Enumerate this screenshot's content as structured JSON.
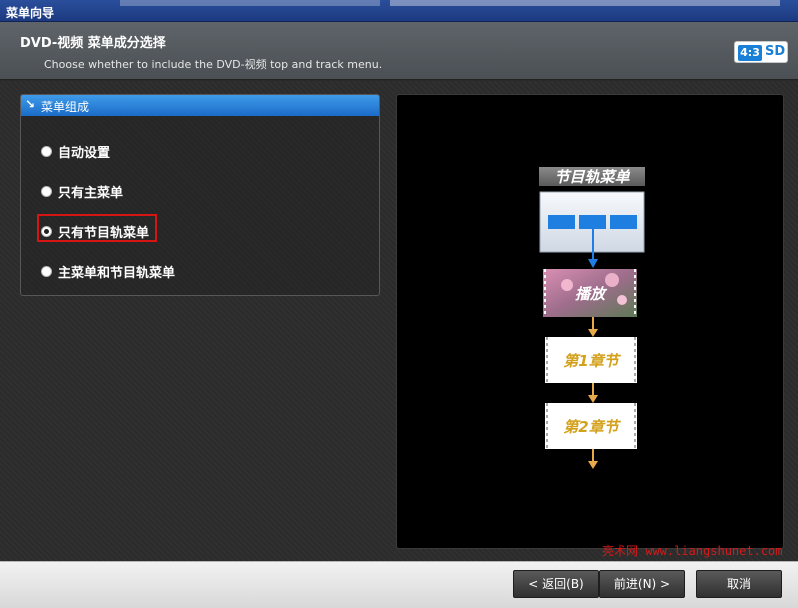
{
  "window": {
    "title": "菜单向导"
  },
  "header": {
    "title": "DVD-视频 菜单成分选择",
    "subtitle": "Choose whether to include the DVD-视频 top and track menu.",
    "badge": {
      "ratio": "4:3",
      "definition": "SD"
    }
  },
  "group": {
    "title": "菜单组成",
    "options": [
      {
        "label": "自动设置",
        "checked": false
      },
      {
        "label": "只有主菜单",
        "checked": false
      },
      {
        "label": "只有节目轨菜单",
        "checked": true
      },
      {
        "label": "主菜单和节目轨菜单",
        "checked": false
      }
    ]
  },
  "preview": {
    "menu_title": "节目轨菜单",
    "play_label": "播放",
    "chapters": [
      "第1章节",
      "第2章节"
    ]
  },
  "watermark": "亮术网 www.liangshunet.com",
  "footer": {
    "back_label": "< 返回(B)",
    "next_label": "前进(N) >",
    "cancel_label": "取消"
  },
  "colors": {
    "accent": "#1a7fd6",
    "highlight_box": "#d51414",
    "arrow_blue": "#1f7ee6",
    "arrow_orange": "#e8a94a",
    "chapter_text": "#d4a11c"
  }
}
